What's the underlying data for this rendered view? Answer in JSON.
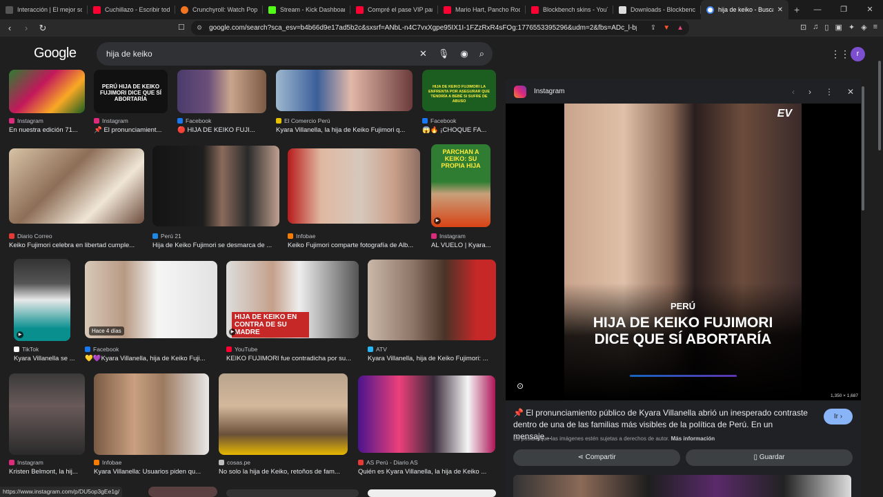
{
  "tabs": [
    {
      "label": "Interacción | El mejor softw",
      "color": "#e8e8e8"
    },
    {
      "label": "Cuchillazo - Escribir todo c",
      "color": "#ff0033"
    },
    {
      "label": "Crunchyroll: Watch Popular",
      "color": "#f47521"
    },
    {
      "label": "Stream - Kick Dashboard",
      "color": "#53fc18"
    },
    {
      "label": "Compré el pase VIP para e",
      "color": "#ff0033"
    },
    {
      "label": "Mario Hart, Pancho Rodríg",
      "color": "#ff0033"
    },
    {
      "label": "Blockbench skins - YouTub",
      "color": "#ff0033"
    },
    {
      "label": "Downloads - Blockbench",
      "color": "#e8e8e8"
    },
    {
      "label": "hija de keiko - Buscar",
      "color": "#4285f4",
      "active": true
    }
  ],
  "address": {
    "url": "google.com/search?sca_esv=b4b66d9e17ad5b2c&sxsrf=ANbL-n4C7vxXgpe95IX1I-1FZzRxR4sFOg:1776553395296&udm=2&fbs=ADc_l-bpk8W4E-qs..."
  },
  "header": {
    "logo": "Google",
    "query": "hija de keiko",
    "avatar_letter": "r"
  },
  "results": [
    {
      "source": "Instagram",
      "title": "En nuestra edición 71...",
      "src_color": "#dd2a7b"
    },
    {
      "source": "Instagram",
      "title": "📌 El pronunciamient...",
      "src_color": "#dd2a7b"
    },
    {
      "source": "Facebook",
      "title": "🔴 HIJA DE KEIKO FUJI...",
      "src_color": "#1877f2"
    },
    {
      "source": "El Comercio Perú",
      "title": "Kyara Villanella, la hija de Keiko Fujimori q...",
      "src_color": "#e5c100"
    },
    {
      "source": "Facebook",
      "title": "😱🔥 ¡CHOQUE FA...",
      "src_color": "#1877f2"
    },
    {
      "source": "Diario Correo",
      "title": "Keiko Fujimori celebra en libertad cumple...",
      "src_color": "#e53935"
    },
    {
      "source": "Perú 21",
      "title": "Hija de Keiko Fujimori se desmarca de ...",
      "src_color": "#1e88e5"
    },
    {
      "source": "Infobae",
      "title": "Keiko Fujimori comparte fotografía de Alb...",
      "src_color": "#f57c00"
    },
    {
      "source": "Instagram",
      "title": "AL VUELO | Kyara...",
      "src_color": "#dd2a7b"
    },
    {
      "source": "TikTok",
      "title": "Kyara Villanella se ...",
      "src_color": "#ffffff"
    },
    {
      "source": "Facebook",
      "title": "💛💜Kyara Villanella, hija de Keiko Fuji...",
      "src_color": "#1877f2"
    },
    {
      "source": "YouTube",
      "title": "KEIKO FUJIMORI fue contradicha por su...",
      "src_color": "#ff0033"
    },
    {
      "source": "ATV",
      "title": "Kyara Villanella, hija de Keiko Fujimori: ...",
      "src_color": "#29b6f6"
    },
    {
      "source": "Instagram",
      "title": "Kristen Belmont, la hij...",
      "src_color": "#dd2a7b"
    },
    {
      "source": "Infobae",
      "title": "Kyara Villanella: Usuarios piden qu...",
      "src_color": "#f57c00"
    },
    {
      "source": "cosas.pe",
      "title": "No solo la hija de Keiko, retoños de fam...",
      "src_color": "#bdbdbd"
    },
    {
      "source": "AS Perú - Diario AS",
      "title": "Quién es Kyara Villanella, la hija de Keiko ...",
      "src_color": "#e53935"
    }
  ],
  "overlays": {
    "thumb2": "PERÚ HIJA DE KEIKO FUJIMORI DICE QUE SÍ ABORTARÍA",
    "thumb5": "HIJA DE KEIKO FUJIMORI LA ENFRENTA POR ASEGURAR QUE TENDRÍA A BEBÉ SI SUFRE DE ABUSO",
    "thumb9": "PARCHAN A KEIKO: SU PROPIA HIJA",
    "thumb11_time": "Hace 4 días",
    "thumb12": "HIJA DE KEIKO EN CONTRA DE SU MADRE"
  },
  "preview": {
    "source": "Instagram",
    "image_text_1": "PERÚ",
    "image_text_2": "HIJA DE KEIKO FUJIMORI DICE QUE SÍ ABORTARÍA",
    "dimensions": "1,350 × 1,687",
    "description": "📌 El pronunciamiento público de Kyara Villanella abrió un inesperado contraste dentro de una de las familias más visibles de la política de Perú. En un mensaje...",
    "visit_label": "Ir ›",
    "copyright": "Es posible que las imágenes estén sujetas a derechos de autor.",
    "more_info": "Más información",
    "share_label": "Compartir",
    "save_label": "Guardar"
  },
  "status_url": "https://www.instagram.com/p/DU5op3gEe1g/"
}
